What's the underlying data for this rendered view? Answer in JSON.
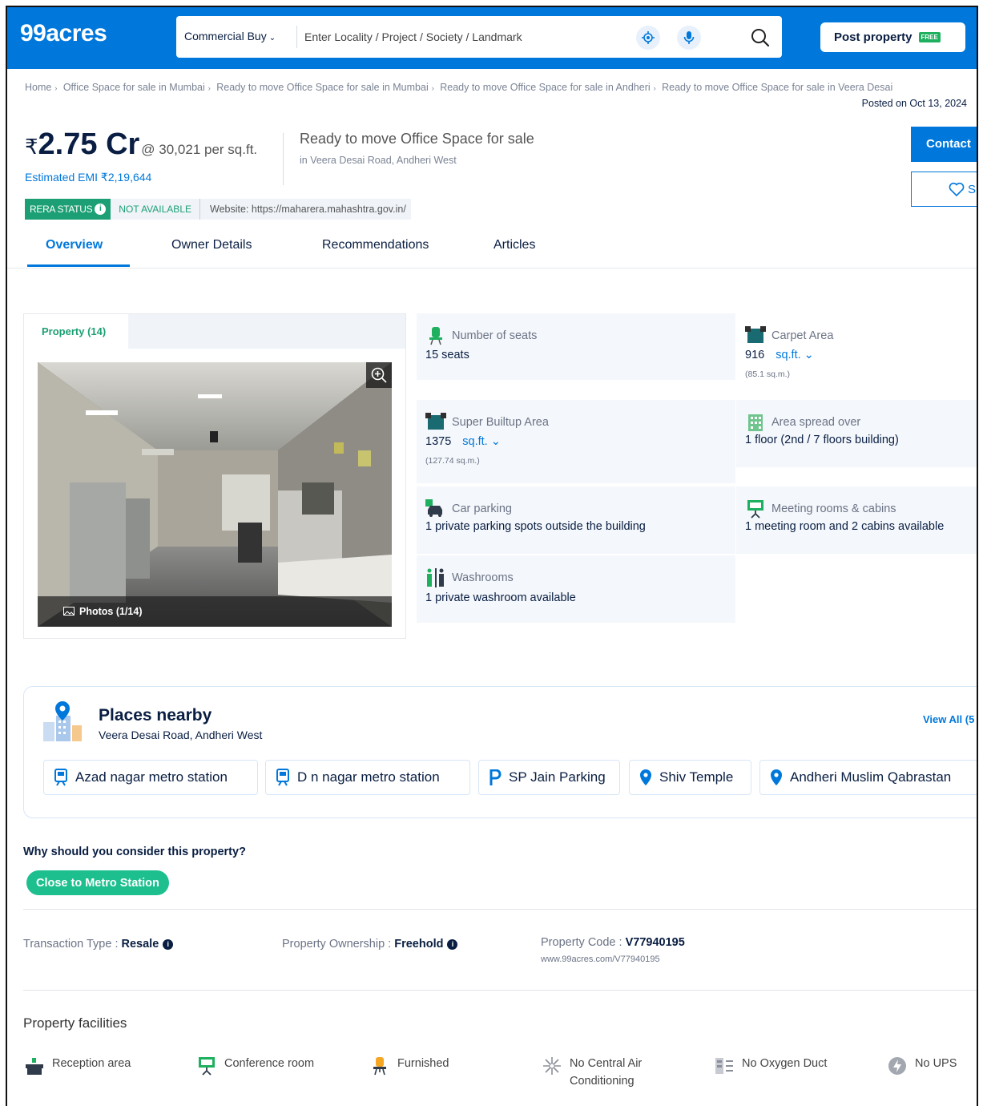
{
  "header": {
    "logo": "99acres",
    "search_type": "Commercial Buy",
    "search_placeholder": "Enter Locality / Project / Society / Landmark",
    "post_property": "Post property",
    "free_badge": "FREE"
  },
  "breadcrumb": {
    "items": [
      "Home",
      "Office Space for sale in Mumbai",
      "Ready to move Office Space for sale in Mumbai",
      "Ready to move Office Space for sale in Andheri",
      "Ready to move Office Space for sale in Veera Desai"
    ],
    "posted": "Posted on Oct 13, 2024"
  },
  "listing": {
    "currency": "₹",
    "price": "2.75 Cr",
    "per_sqft": "@ 30,021 per sq.ft.",
    "emi": "Estimated EMI ₹2,19,644",
    "title": "Ready to move Office Space for sale",
    "location": "in Veera Desai Road, Andheri West",
    "contact_label": "Contact",
    "shortlist_label": "S",
    "rera_status": "RERA STATUS",
    "rera_value": "NOT AVAILABLE",
    "rera_website": "Website: https://maharera.mahashtra.gov.in/"
  },
  "tabs": [
    "Overview",
    "Owner Details",
    "Recommendations",
    "Articles"
  ],
  "gallery": {
    "tab": "Property (14)",
    "caption": "Photos (1/14)"
  },
  "specs": {
    "seats": {
      "label": "Number of seats",
      "value": "15 seats"
    },
    "carpet": {
      "label": "Carpet Area",
      "value": "916",
      "unit": "sq.ft.",
      "sub": "(85.1 sq.m.)"
    },
    "super": {
      "label": "Super Builtup Area",
      "value": "1375",
      "unit": "sq.ft.",
      "sub": "(127.74 sq.m.)"
    },
    "spread": {
      "label": "Area spread over",
      "value": "1 floor (2nd / 7 floors building)"
    },
    "parking": {
      "label": "Car parking",
      "value": "1 private parking spots outside the building"
    },
    "meeting": {
      "label": "Meeting rooms & cabins",
      "value": "1 meeting room and 2 cabins available"
    },
    "washroom": {
      "label": "Washrooms",
      "value": "1 private washroom available"
    }
  },
  "places": {
    "title": "Places nearby",
    "subtitle": "Veera Desai Road, Andheri West",
    "view_all": "View All (5",
    "chips": [
      "Azad nagar metro station",
      "D n nagar metro station",
      "SP Jain Parking",
      "Shiv Temple",
      "Andheri Muslim Qabrastan"
    ]
  },
  "why": {
    "title": "Why should you consider this property?",
    "badge": "Close to Metro Station"
  },
  "details": {
    "transaction_label": "Transaction Type : ",
    "transaction_value": "Resale",
    "ownership_label": "Property Ownership : ",
    "ownership_value": "Freehold",
    "code_label": "Property Code : ",
    "code_value": "V77940195",
    "code_url": "www.99acres.com/V77940195"
  },
  "facilities": {
    "title": "Property facilities",
    "items": [
      "Reception area",
      "Conference room",
      "Furnished",
      "No Central Air Conditioning",
      "No Oxygen Duct",
      "No UPS"
    ]
  },
  "colors": {
    "brand_blue": "#0078DB",
    "rera_green": "#1C9F74",
    "badge_green": "#1DBF8E",
    "spec_bg": "#F4F7FB"
  }
}
